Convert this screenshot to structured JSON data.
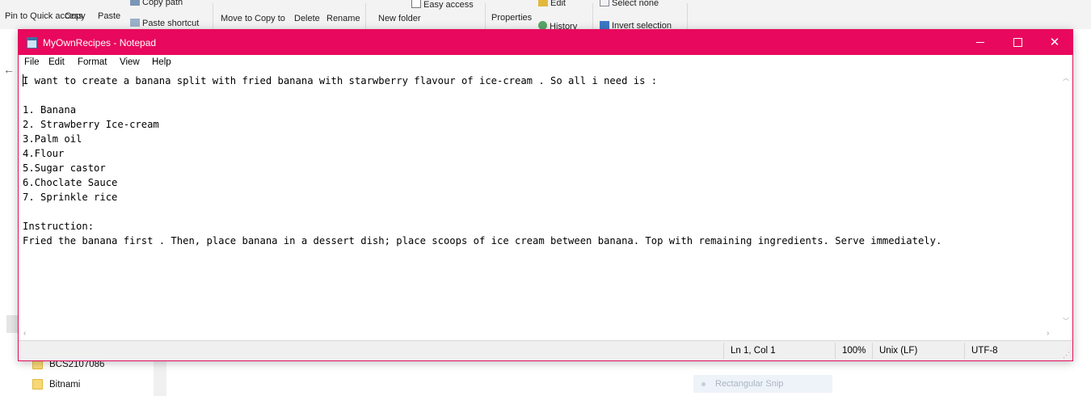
{
  "explorer": {
    "ribbon": {
      "pin_quick_access": "Pin to Quick access",
      "copy": "Copy",
      "paste": "Paste",
      "copy_path": "Copy path",
      "paste_shortcut": "Paste shortcut",
      "move_to": "Move to",
      "copy_to": "Copy to",
      "delete": "Delete",
      "rename": "Rename",
      "new_folder": "New folder",
      "easy_access": "Easy access",
      "properties": "Properties",
      "edit": "Edit",
      "history": "History",
      "select_none": "Select none",
      "invert_selection": "Invert selection"
    },
    "folders": [
      "BCS2107086",
      "Bitnami"
    ],
    "snip_label": "Rectangular Snip"
  },
  "notepad": {
    "title": "MyOwnRecipes - Notepad",
    "window_buttons": {
      "minimize": "—",
      "maximize": "□",
      "close": "✕"
    },
    "menu": [
      "File",
      "Edit",
      "Format",
      "View",
      "Help"
    ],
    "lines": [
      "I want to create a banana split with fried banana with starwberry flavour of ice-cream . So all i need is :",
      "",
      "1. Banana",
      "2. Strawberry Ice-cream",
      "3.Palm oil",
      "4.Flour",
      "5.Sugar castor",
      "6.Choclate Sauce",
      "7. Sprinkle rice",
      "",
      "Instruction:",
      "Fried the banana first . Then, place banana in a dessert dish; place scoops of ice cream between banana. Top with remaining ingredients. Serve immediately."
    ],
    "status": {
      "position": "Ln 1, Col 1",
      "zoom": "100%",
      "line_ending": "Unix (LF)",
      "encoding": "UTF-8"
    },
    "colors": {
      "titlebar": "#e8085d",
      "border": "#e3105d"
    }
  }
}
